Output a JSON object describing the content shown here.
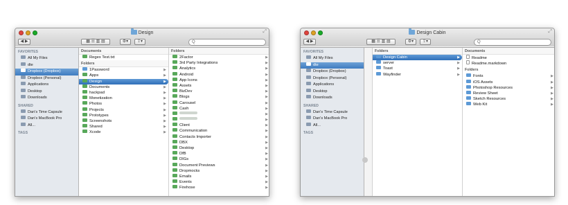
{
  "window1": {
    "title": "Design",
    "search_placeholder": "Q",
    "sidebar": {
      "favorites_heading": "FAVORITES",
      "favorites": [
        "All My Files",
        "dte",
        "Dropbox (Dropbox)",
        "Dropbox (Personal)",
        "Applications",
        "Desktop",
        "Downloads"
      ],
      "shared_heading": "SHARED",
      "shared": [
        "Dan's Time Capsule",
        "Dan's MacBook Pro",
        "All..."
      ],
      "tags_heading": "TAGS"
    },
    "col1": {
      "documents_heading": "Documents",
      "documents": [
        "Regex Test.txt"
      ],
      "folders_heading": "Folders",
      "folders": [
        "1Password",
        "Apps",
        "Design",
        "Documents",
        "hackpad",
        "Monetization",
        "Photos",
        "Projects",
        "Prototypes",
        "Screenshots",
        "Shared",
        "Xcode"
      ]
    },
    "col2": {
      "folders_heading": "Folders",
      "folders": [
        "2Factor",
        "3rd Party Integrations",
        "Analytics",
        "Android",
        "App Icons",
        "Assets",
        "BizDev",
        "Blogs",
        "Carousel",
        "Cash",
        "",
        "",
        "Client",
        "Communication",
        "Contacts Importer",
        "DBX",
        "Desktop",
        "DfB",
        "DIGs",
        "Document Previews",
        "Dropmocks",
        "Emails",
        "Events",
        "Firehose"
      ]
    }
  },
  "window2": {
    "title": "Design Cabin",
    "search_placeholder": "Q",
    "sidebar": {
      "favorites_heading": "FAVORITES",
      "favorites": [
        "All My Files",
        "dte",
        "Dropbox (Dropbox)",
        "Dropbox (Personal)",
        "Applications",
        "Desktop",
        "Downloads"
      ],
      "shared_heading": "SHARED",
      "shared": [
        "Dan's Time Capsule",
        "Dan's MacBook Pro",
        "All..."
      ],
      "tags_heading": "TAGS"
    },
    "col1": {
      "folders_heading": "Folders",
      "folders": [
        "Design Cabin",
        "server",
        "Toast",
        "Wayfinder"
      ]
    },
    "col2": {
      "documents_heading": "Documents",
      "documents": [
        "Readme",
        "Readme.markdown"
      ],
      "folders_heading": "Folders",
      "folders": [
        "Fonts",
        "iOS Assets",
        "Photoshop Resources",
        "Review Sheet",
        "Sketch Resources",
        "Web Kit"
      ]
    }
  },
  "colors": {
    "selection": "#3f7cc0",
    "folder": "#5d9ad6",
    "sidebar_bg": "#e5e9ee"
  }
}
